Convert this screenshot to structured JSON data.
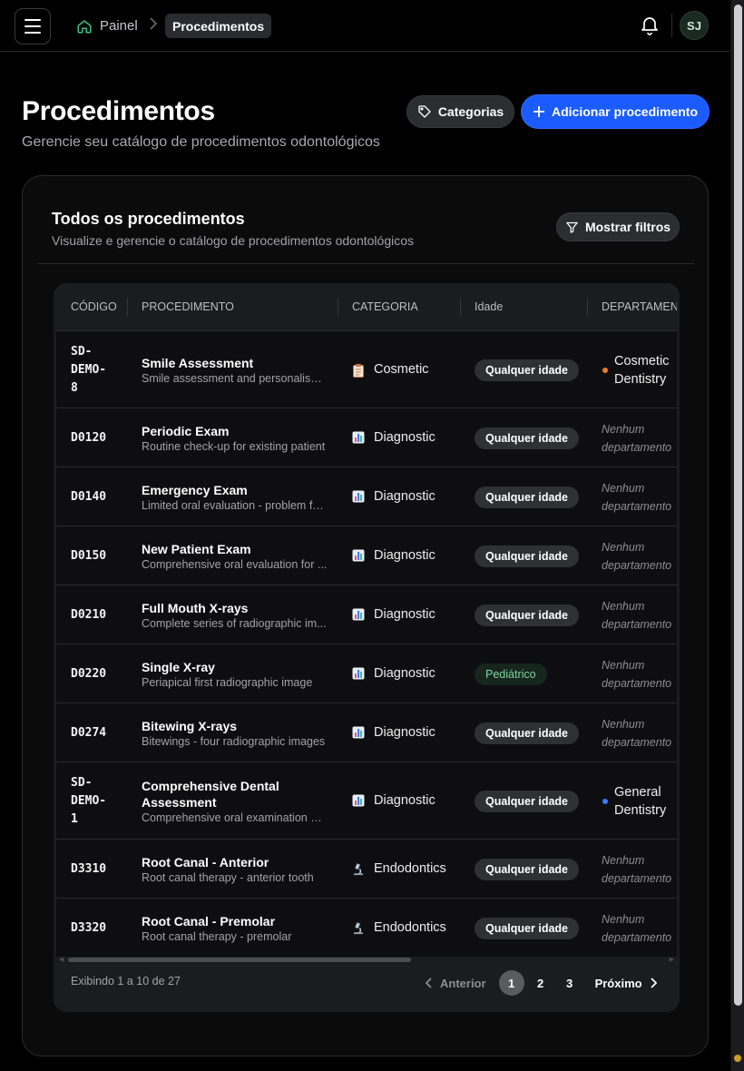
{
  "topbar": {
    "breadcrumb_home": "Painel",
    "breadcrumb_current": "Procedimentos",
    "avatar_initials": "SJ"
  },
  "header": {
    "title": "Procedimentos",
    "subtitle": "Gerencie seu catálogo de procedimentos odontológicos",
    "categories_button": "Categorias",
    "add_button": "Adicionar procedimento"
  },
  "card": {
    "title": "Todos os procedimentos",
    "subtitle": "Visualize e gerencie o catálogo de procedimentos odontológicos",
    "filter_button": "Mostrar filtros"
  },
  "table": {
    "columns": {
      "code": "CÓDIGO",
      "procedure": "PROCEDIMENTO",
      "category": "CATEGORIA",
      "age": "Idade",
      "department": "DEPARTAMENT"
    },
    "rows": [
      {
        "code": [
          "SD-",
          "DEMO-",
          "8"
        ],
        "name": [
          "Smile Assessment"
        ],
        "desc": "Smile assessment and personalised ...",
        "category": "Cosmetic",
        "category_icon": "clipboard-icon",
        "age": "Qualquer idade",
        "age_kind": "any",
        "dept": [
          "Cosmetic",
          "Dentistry"
        ],
        "dept_color": "#f07a2a"
      },
      {
        "code": [
          "D0120"
        ],
        "name": [
          "Periodic Exam"
        ],
        "desc": "Routine check-up for existing patient",
        "category": "Diagnostic",
        "category_icon": "bar-chart-icon",
        "age": "Qualquer idade",
        "age_kind": "any",
        "dept": [
          "Nenhum",
          "departamento"
        ],
        "dept_color": ""
      },
      {
        "code": [
          "D0140"
        ],
        "name": [
          "Emergency Exam"
        ],
        "desc": "Limited oral evaluation - problem fo...",
        "category": "Diagnostic",
        "category_icon": "bar-chart-icon",
        "age": "Qualquer idade",
        "age_kind": "any",
        "dept": [
          "Nenhum",
          "departamento"
        ],
        "dept_color": ""
      },
      {
        "code": [
          "D0150"
        ],
        "name": [
          "New Patient Exam"
        ],
        "desc": "Comprehensive oral evaluation for ...",
        "category": "Diagnostic",
        "category_icon": "bar-chart-icon",
        "age": "Qualquer idade",
        "age_kind": "any",
        "dept": [
          "Nenhum",
          "departamento"
        ],
        "dept_color": ""
      },
      {
        "code": [
          "D0210"
        ],
        "name": [
          "Full Mouth X-rays"
        ],
        "desc": "Complete series of radiographic im...",
        "category": "Diagnostic",
        "category_icon": "bar-chart-icon",
        "age": "Qualquer idade",
        "age_kind": "any",
        "dept": [
          "Nenhum",
          "departamento"
        ],
        "dept_color": ""
      },
      {
        "code": [
          "D0220"
        ],
        "name": [
          "Single X-ray"
        ],
        "desc": "Periapical first radiographic image",
        "category": "Diagnostic",
        "category_icon": "bar-chart-icon",
        "age": "Pediátrico",
        "age_kind": "ped",
        "dept": [
          "Nenhum",
          "departamento"
        ],
        "dept_color": ""
      },
      {
        "code": [
          "D0274"
        ],
        "name": [
          "Bitewing X-rays"
        ],
        "desc": "Bitewings - four radiographic images",
        "category": "Diagnostic",
        "category_icon": "bar-chart-icon",
        "age": "Qualquer idade",
        "age_kind": "any",
        "dept": [
          "Nenhum",
          "departamento"
        ],
        "dept_color": ""
      },
      {
        "code": [
          "SD-",
          "DEMO-",
          "1"
        ],
        "name": [
          "Comprehensive Dental",
          "Assessment"
        ],
        "desc": "Comprehensive oral examination an...",
        "category": "Diagnostic",
        "category_icon": "bar-chart-icon",
        "age": "Qualquer idade",
        "age_kind": "any",
        "dept": [
          "General",
          "Dentistry"
        ],
        "dept_color": "#3b7bff"
      },
      {
        "code": [
          "D3310"
        ],
        "name": [
          "Root Canal - Anterior"
        ],
        "desc": "Root canal therapy - anterior tooth",
        "category": "Endodontics",
        "category_icon": "microscope-icon",
        "age": "Qualquer idade",
        "age_kind": "any",
        "dept": [
          "Nenhum",
          "departamento"
        ],
        "dept_color": ""
      },
      {
        "code": [
          "D3320"
        ],
        "name": [
          "Root Canal - Premolar"
        ],
        "desc": "Root canal therapy - premolar",
        "category": "Endodontics",
        "category_icon": "microscope-icon",
        "age": "Qualquer idade",
        "age_kind": "any",
        "dept": [
          "Nenhum",
          "departamento"
        ],
        "dept_color": ""
      }
    ]
  },
  "pagination": {
    "info": "Exibindo 1 a 10 de 27",
    "prev": "Anterior",
    "pages": [
      "1",
      "2",
      "3"
    ],
    "active_page": "1",
    "next": "Próximo"
  }
}
